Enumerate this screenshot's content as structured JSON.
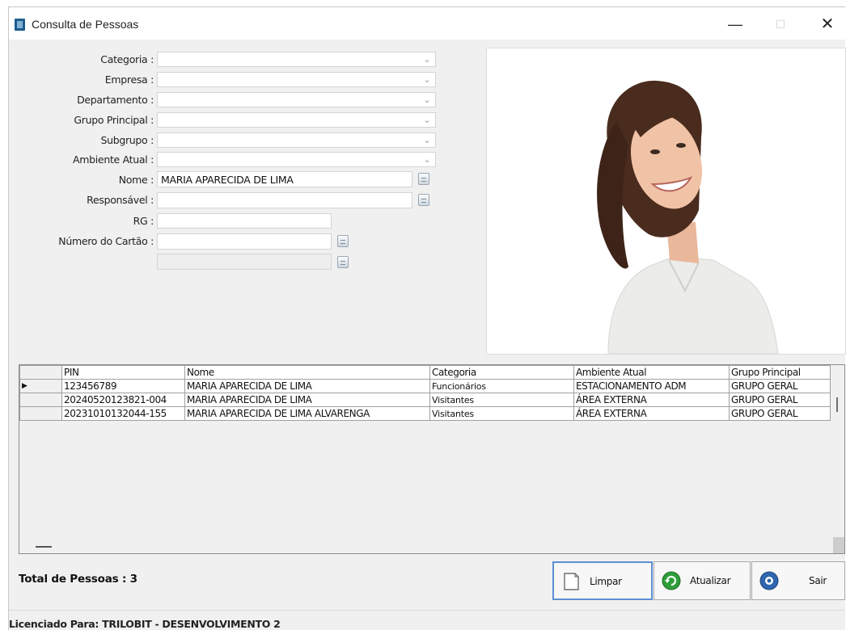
{
  "window": {
    "title": "Consulta de Pessoas",
    "minimize_glyph": "—",
    "maximize_glyph": "☐",
    "close_glyph": "✕"
  },
  "form": {
    "categoria_label": "Categoria :",
    "empresa_label": "Empresa :",
    "departamento_label": "Departamento :",
    "grupo_principal_label": "Grupo Principal :",
    "subgrupo_label": "Subgrupo :",
    "ambiente_atual_label": "Ambiente Atual :",
    "nome_label": "Nome :",
    "nome_value": "MARIA APARECIDA DE LIMA",
    "responsavel_label": "Responsável :",
    "responsavel_value": "",
    "rg_label": "RG :",
    "rg_value": "",
    "numero_cartao_label": "Número do Cartão :",
    "numero_cartao_value": "",
    "extra_value": "",
    "dropdown_glyph": "⌄"
  },
  "grid": {
    "columns": [
      "PIN",
      "Nome",
      "Categoria",
      "Ambiente Atual",
      "Grupo Principal"
    ],
    "rows": [
      [
        "123456789",
        "MARIA APARECIDA DE LIMA",
        "Funcionários",
        "ESTACIONAMENTO ADM",
        "GRUPO GERAL"
      ],
      [
        "20240520123821-004",
        "MARIA APARECIDA DE LIMA",
        "Visitantes",
        "ÁREA EXTERNA",
        "GRUPO GERAL"
      ],
      [
        "20231010132044-155",
        "MARIA APARECIDA DE LIMA ALVARENGA",
        "Visitantes",
        "ÁREA EXTERNA",
        "GRUPO GERAL"
      ]
    ],
    "selected_row": 0,
    "row_indicator": "▶"
  },
  "footer": {
    "total_label": "Total de Pessoas : 3",
    "licensed_label": "Licenciado Para: TRILOBIT - DESENVOLVIMENTO 2"
  },
  "buttons": {
    "limpar": "Limpar",
    "atualizar": "Atualizar",
    "sair": "Sair"
  },
  "colors": {
    "window_bg": "#f0f0f0",
    "accent": "#5b8fd3",
    "refresh_icon": "#2e9e3a",
    "exit_icon": "#2f66b0"
  }
}
